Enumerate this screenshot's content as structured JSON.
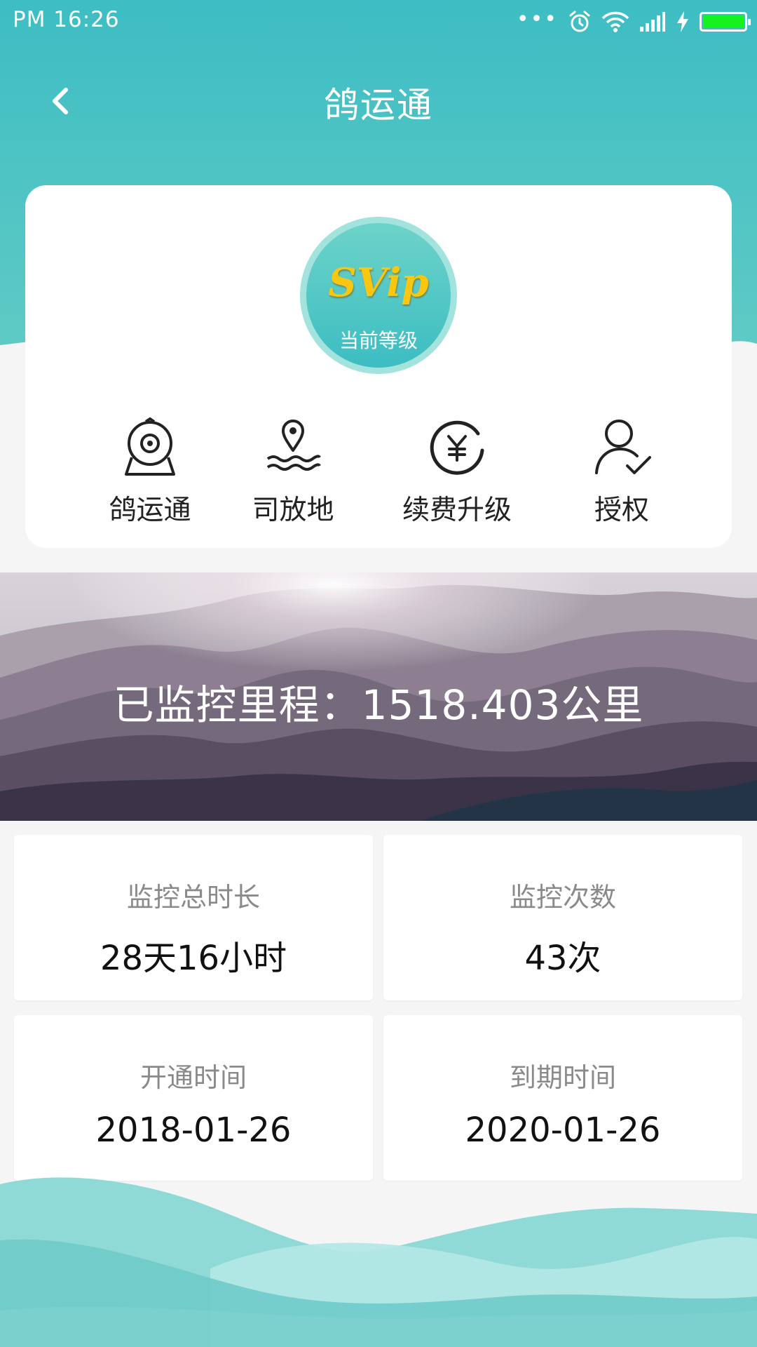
{
  "status_bar": {
    "time": "PM  16:26",
    "icons": [
      "more-dots-icon",
      "alarm-icon",
      "wifi-icon",
      "signal-icon",
      "charging-icon",
      "battery-icon"
    ],
    "battery_level": 1.0,
    "battery_color": "#15f21d"
  },
  "nav": {
    "title": "鸽运通",
    "back_icon": "chevron-left-icon"
  },
  "colors": {
    "theme_teal": "#3dbdc3",
    "theme_teal_light": "#8fd9d6",
    "svip_gold": "#f9c70f"
  },
  "level": {
    "badge_text": "SVip",
    "label": "当前等级"
  },
  "shortcuts": [
    {
      "label": "鸽运通",
      "icon": "camera-icon"
    },
    {
      "label": "司放地",
      "icon": "location-pin-icon"
    },
    {
      "label": "续费升级",
      "icon": "yen-renew-icon"
    },
    {
      "label": "授权",
      "icon": "user-check-icon"
    }
  ],
  "banner": {
    "mileage_text": "已监控里程：1518.403公里"
  },
  "stats": [
    {
      "label": "监控总时长",
      "value": "28天16小时"
    },
    {
      "label": "监控次数",
      "value": "43次"
    },
    {
      "label": "开通时间",
      "value": "2018-01-26"
    },
    {
      "label": "到期时间",
      "value": "2020-01-26"
    }
  ]
}
